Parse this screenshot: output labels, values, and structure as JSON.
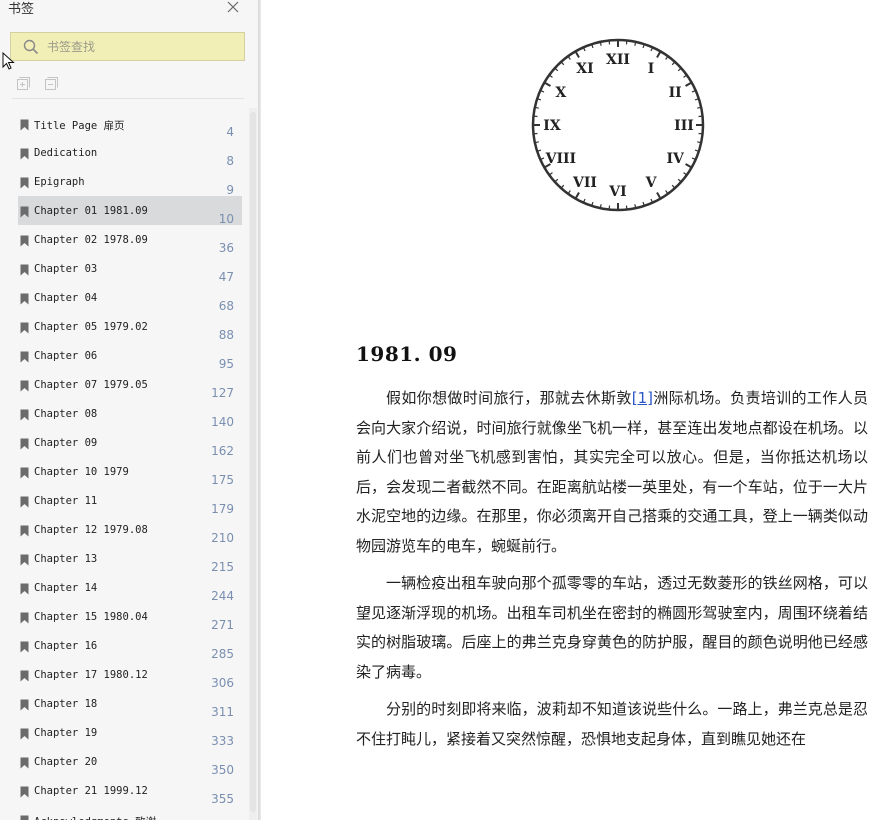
{
  "sidebar": {
    "title": "书签",
    "search": {
      "placeholder": "书签查找",
      "value": ""
    },
    "bookmarks": [
      {
        "label": "Title Page 扉页",
        "page": "4"
      },
      {
        "label": "Dedication",
        "page": "8"
      },
      {
        "label": "Epigraph",
        "page": "9"
      },
      {
        "label": "Chapter 01 1981.09",
        "page": "10",
        "selected": true
      },
      {
        "label": "Chapter 02 1978.09",
        "page": "36"
      },
      {
        "label": "Chapter 03",
        "page": "47"
      },
      {
        "label": "Chapter 04",
        "page": "68"
      },
      {
        "label": "Chapter 05 1979.02",
        "page": "88"
      },
      {
        "label": "Chapter 06",
        "page": "95"
      },
      {
        "label": "Chapter 07 1979.05",
        "page": "127"
      },
      {
        "label": "Chapter 08",
        "page": "140"
      },
      {
        "label": "Chapter 09",
        "page": "162"
      },
      {
        "label": "Chapter 10 1979",
        "page": "175"
      },
      {
        "label": "Chapter 11",
        "page": "179"
      },
      {
        "label": "Chapter 12 1979.08",
        "page": "210"
      },
      {
        "label": "Chapter 13",
        "page": "215"
      },
      {
        "label": "Chapter 14",
        "page": "244"
      },
      {
        "label": "Chapter 15 1980.04",
        "page": "271"
      },
      {
        "label": "Chapter 16",
        "page": "285"
      },
      {
        "label": "Chapter 17 1980.12",
        "page": "306"
      },
      {
        "label": "Chapter 18",
        "page": "311"
      },
      {
        "label": "Chapter 19",
        "page": "333"
      },
      {
        "label": "Chapter 20",
        "page": "350"
      },
      {
        "label": "Chapter 21 1999.12",
        "page": "355"
      },
      {
        "label": "Acknowledgments 致谢",
        "page": ""
      }
    ],
    "colors": {
      "search_bg": "#f2efb6",
      "selected_bg": "#d9dadc",
      "page_num": "#7a8fb0"
    }
  },
  "document": {
    "clock_numerals": [
      "XII",
      "I",
      "II",
      "III",
      "IV",
      "V",
      "VI",
      "VII",
      "VIII",
      "IX",
      "X",
      "XI"
    ],
    "chapter_title": "1981. 09",
    "p1_before_link": "假如你想做时间旅行，那就去休斯敦",
    "footnote_link": "[1]",
    "p1_after_link": "洲际机场。负责培训的工作人员会向大家介绍说，时间旅行就像坐飞机一样，甚至连出发地点都设在机场。以前人们也曾对坐飞机感到害怕，其实完全可以放心。但是，当你抵达机场以后，会发现二者截然不同。在距离航站楼一英里处，有一个车站，位于一大片水泥空地的边缘。在那里，你必须离开自己搭乘的交通工具，登上一辆类似动物园游览车的电车，蜿蜒前行。",
    "p2": "一辆检疫出租车驶向那个孤零零的车站，透过无数菱形的铁丝网格，可以望见逐渐浮现的机场。出租车司机坐在密封的椭圆形驾驶室内，周围环绕着结实的树脂玻璃。后座上的弗兰克身穿黄色的防护服，醒目的颜色说明他已经感染了病毒。",
    "p3": "分别的时刻即将来临，波莉却不知道该说些什么。一路上，弗兰克总是忍不住打盹儿，紧接着又突然惊醒，恐惧地支起身体，直到瞧见她还在"
  }
}
